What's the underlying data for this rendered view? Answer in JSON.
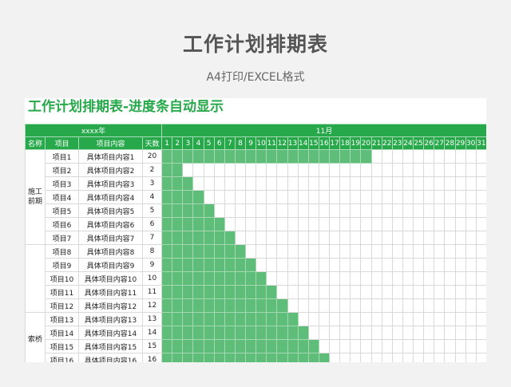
{
  "page": {
    "title": "工作计划排期表",
    "subtitle": "A4打印/EXCEL格式"
  },
  "sheet": {
    "title": "工作计划排期表-进度条自动显示",
    "year_label": "xxxx年",
    "month_label": "11月",
    "headers": {
      "name": "名称",
      "item": "项目",
      "content": "项目内容",
      "days": "天数"
    },
    "day_numbers": [
      1,
      2,
      3,
      4,
      5,
      6,
      7,
      8,
      9,
      10,
      11,
      12,
      13,
      14,
      15,
      16,
      17,
      18,
      19,
      20,
      21,
      22,
      23,
      24,
      25,
      26,
      27,
      28,
      29,
      30,
      31
    ],
    "groups": [
      {
        "label": "施工前期",
        "rows": 7
      },
      {
        "label": "",
        "rows": 5
      },
      {
        "label": "索桥",
        "rows": 4
      }
    ],
    "rows": [
      {
        "item": "项目1",
        "content": "具体项目内容1",
        "days": 20
      },
      {
        "item": "项目2",
        "content": "具体项目内容2",
        "days": 2
      },
      {
        "item": "项目3",
        "content": "具体项目内容3",
        "days": 3
      },
      {
        "item": "项目4",
        "content": "具体项目内容4",
        "days": 4
      },
      {
        "item": "项目5",
        "content": "具体项目内容5",
        "days": 5
      },
      {
        "item": "项目6",
        "content": "具体项目内容6",
        "days": 6
      },
      {
        "item": "项目7",
        "content": "具体项目内容7",
        "days": 7
      },
      {
        "item": "项目8",
        "content": "具体项目内容8",
        "days": 8
      },
      {
        "item": "项目9",
        "content": "具体项目内容9",
        "days": 9
      },
      {
        "item": "项目10",
        "content": "具体项目内容10",
        "days": 10
      },
      {
        "item": "项目11",
        "content": "具体项目内容11",
        "days": 11
      },
      {
        "item": "项目12",
        "content": "具体项目内容12",
        "days": 12
      },
      {
        "item": "项目13",
        "content": "具体项目内容13",
        "days": 13
      },
      {
        "item": "项目14",
        "content": "具体项目内容14",
        "days": 14
      },
      {
        "item": "项目15",
        "content": "具体项目内容15",
        "days": 15
      },
      {
        "item": "项目16",
        "content": "具体项目内容16",
        "days": 16
      }
    ],
    "colors": {
      "accent": "#27a84a",
      "bar": "#5fbd7a"
    }
  }
}
